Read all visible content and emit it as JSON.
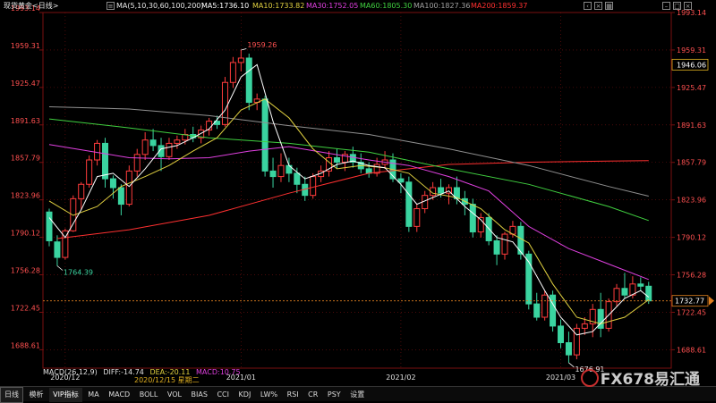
{
  "header": {
    "instrument": "现货黄金<日线>",
    "ma_label": "MA(5,10,30,60,100,200)",
    "ma5": "MA5:1736.10",
    "ma10": "MA10:1733.82",
    "ma30": "MA30:1752.05",
    "ma60": "MA60:1805.30",
    "ma100": "MA100:1827.36",
    "ma200": "MA200:1859.37"
  },
  "colors": {
    "up": "#ff3c3c",
    "down": "#3ad4a0",
    "ma5": "#ffffff",
    "ma10": "#e0d040",
    "ma30": "#e040e0",
    "ma60": "#40d040",
    "ma100": "#909090",
    "ma200": "#ff3030",
    "grid": "#7a1010",
    "axis_text": "#ff5050"
  },
  "icons": [
    "menu-icon",
    "back-icon",
    "close-icon",
    "grid-icon",
    "minimize-icon",
    "maximize-icon",
    "close-window-icon"
  ],
  "chart_data": {
    "type": "candlestick",
    "ylim": [
      1672,
      1993.14
    ],
    "yticks": [
      "1993.14",
      "1959.31",
      "1925.47",
      "1891.63",
      "1857.79",
      "1823.96",
      "1790.12",
      "1756.28",
      "1722.45",
      "1688.61"
    ],
    "xticks": [
      {
        "label": "2020/12",
        "index": 2
      },
      {
        "label": "2021/01",
        "index": 24
      },
      {
        "label": "2021/02",
        "index": 44
      },
      {
        "label": "2021/03",
        "index": 64
      }
    ],
    "candles": [
      [
        1813,
        1816,
        1782,
        1787
      ],
      [
        1786,
        1792,
        1764.39,
        1772
      ],
      [
        1772,
        1798,
        1770,
        1796
      ],
      [
        1796,
        1828,
        1795,
        1825
      ],
      [
        1825,
        1840,
        1815,
        1838
      ],
      [
        1838,
        1864,
        1835,
        1860
      ],
      [
        1860,
        1878,
        1855,
        1875
      ],
      [
        1875,
        1880,
        1835,
        1843
      ],
      [
        1843,
        1846,
        1825,
        1835
      ],
      [
        1835,
        1838,
        1810,
        1820
      ],
      [
        1820,
        1855,
        1818,
        1850
      ],
      [
        1850,
        1870,
        1845,
        1865
      ],
      [
        1865,
        1885,
        1860,
        1878
      ],
      [
        1878,
        1888,
        1868,
        1873
      ],
      [
        1873,
        1880,
        1850,
        1863
      ],
      [
        1863,
        1880,
        1860,
        1875
      ],
      [
        1875,
        1882,
        1870,
        1878
      ],
      [
        1878,
        1888,
        1874,
        1883
      ],
      [
        1883,
        1890,
        1876,
        1880
      ],
      [
        1880,
        1891,
        1875,
        1887
      ],
      [
        1887,
        1898,
        1882,
        1895
      ],
      [
        1895,
        1900,
        1888,
        1892
      ],
      [
        1892,
        1935,
        1890,
        1930
      ],
      [
        1930,
        1953,
        1925,
        1948
      ],
      [
        1948,
        1959.26,
        1940,
        1952
      ],
      [
        1952,
        1956,
        1905,
        1912
      ],
      [
        1912,
        1920,
        1905,
        1915
      ],
      [
        1915,
        1918,
        1845,
        1850
      ],
      [
        1850,
        1862,
        1835,
        1845
      ],
      [
        1845,
        1866,
        1840,
        1855
      ],
      [
        1855,
        1862,
        1840,
        1848
      ],
      [
        1848,
        1853,
        1830,
        1838
      ],
      [
        1838,
        1845,
        1823,
        1828
      ],
      [
        1828,
        1848,
        1825,
        1845
      ],
      [
        1845,
        1855,
        1840,
        1850
      ],
      [
        1850,
        1868,
        1845,
        1862
      ],
      [
        1862,
        1870,
        1852,
        1858
      ],
      [
        1858,
        1868,
        1850,
        1865
      ],
      [
        1865,
        1872,
        1853,
        1858
      ],
      [
        1858,
        1866,
        1848,
        1852
      ],
      [
        1852,
        1858,
        1844,
        1848
      ],
      [
        1848,
        1862,
        1845,
        1856
      ],
      [
        1856,
        1868,
        1852,
        1860
      ],
      [
        1860,
        1866,
        1840,
        1843
      ],
      [
        1843,
        1848,
        1830,
        1840
      ],
      [
        1840,
        1845,
        1795,
        1800
      ],
      [
        1800,
        1820,
        1795,
        1816
      ],
      [
        1816,
        1832,
        1812,
        1828
      ],
      [
        1828,
        1840,
        1824,
        1835
      ],
      [
        1835,
        1843,
        1826,
        1830
      ],
      [
        1830,
        1838,
        1820,
        1835
      ],
      [
        1835,
        1845,
        1820,
        1825
      ],
      [
        1825,
        1832,
        1810,
        1820
      ],
      [
        1820,
        1825,
        1790,
        1795
      ],
      [
        1795,
        1812,
        1790,
        1808
      ],
      [
        1808,
        1812,
        1783,
        1787
      ],
      [
        1787,
        1792,
        1765,
        1775
      ],
      [
        1775,
        1795,
        1770,
        1793
      ],
      [
        1793,
        1805,
        1790,
        1800
      ],
      [
        1800,
        1804,
        1770,
        1775
      ],
      [
        1775,
        1778,
        1725,
        1730
      ],
      [
        1730,
        1740,
        1715,
        1718
      ],
      [
        1718,
        1742,
        1715,
        1738
      ],
      [
        1738,
        1742,
        1705,
        1710
      ],
      [
        1710,
        1716,
        1690,
        1695
      ],
      [
        1695,
        1705,
        1676.91,
        1684
      ],
      [
        1684,
        1712,
        1680,
        1708
      ],
      [
        1708,
        1718,
        1702,
        1712
      ],
      [
        1712,
        1730,
        1700,
        1725
      ],
      [
        1725,
        1740,
        1700,
        1708
      ],
      [
        1708,
        1735,
        1705,
        1732
      ],
      [
        1732,
        1748,
        1728,
        1744
      ],
      [
        1744,
        1758,
        1735,
        1738
      ],
      [
        1738,
        1755,
        1735,
        1748
      ],
      [
        1748,
        1754,
        1742,
        1746
      ],
      [
        1746,
        1750,
        1730,
        1732.77
      ]
    ],
    "ma_series": [
      {
        "name": "MA200",
        "color": "#ff3030",
        "points": [
          [
            1,
            1789
          ],
          [
            10,
            1797
          ],
          [
            20,
            1810
          ],
          [
            30,
            1830
          ],
          [
            40,
            1848
          ],
          [
            50,
            1856
          ],
          [
            60,
            1858
          ],
          [
            70,
            1859
          ],
          [
            75,
            1859.37
          ]
        ]
      },
      {
        "name": "MA100",
        "color": "#909090",
        "points": [
          [
            0,
            1908
          ],
          [
            10,
            1906
          ],
          [
            20,
            1900
          ],
          [
            30,
            1891
          ],
          [
            40,
            1883
          ],
          [
            50,
            1870
          ],
          [
            60,
            1855
          ],
          [
            70,
            1836
          ],
          [
            75,
            1827.36
          ]
        ]
      },
      {
        "name": "MA60",
        "color": "#40d040",
        "points": [
          [
            0,
            1897
          ],
          [
            10,
            1889
          ],
          [
            20,
            1880
          ],
          [
            30,
            1875
          ],
          [
            40,
            1867
          ],
          [
            50,
            1852
          ],
          [
            60,
            1838
          ],
          [
            70,
            1818
          ],
          [
            75,
            1805.3
          ]
        ]
      },
      {
        "name": "MA30",
        "color": "#e040e0",
        "points": [
          [
            0,
            1874
          ],
          [
            5,
            1868
          ],
          [
            10,
            1862
          ],
          [
            15,
            1861
          ],
          [
            20,
            1862
          ],
          [
            25,
            1868
          ],
          [
            30,
            1872
          ],
          [
            35,
            1866
          ],
          [
            40,
            1860
          ],
          [
            45,
            1855
          ],
          [
            50,
            1845
          ],
          [
            55,
            1832
          ],
          [
            60,
            1800
          ],
          [
            65,
            1780
          ],
          [
            70,
            1766
          ],
          [
            75,
            1752.05
          ]
        ]
      },
      {
        "name": "MA10",
        "color": "#e0d040",
        "points": [
          [
            0,
            1823
          ],
          [
            3,
            1810
          ],
          [
            6,
            1818
          ],
          [
            9,
            1836
          ],
          [
            12,
            1845
          ],
          [
            15,
            1855
          ],
          [
            18,
            1868
          ],
          [
            21,
            1880
          ],
          [
            24,
            1905
          ],
          [
            27,
            1915
          ],
          [
            30,
            1898
          ],
          [
            33,
            1870
          ],
          [
            36,
            1852
          ],
          [
            39,
            1855
          ],
          [
            42,
            1853
          ],
          [
            45,
            1848
          ],
          [
            48,
            1830
          ],
          [
            51,
            1826
          ],
          [
            54,
            1816
          ],
          [
            57,
            1797
          ],
          [
            60,
            1785
          ],
          [
            63,
            1748
          ],
          [
            66,
            1718
          ],
          [
            69,
            1712
          ],
          [
            72,
            1718
          ],
          [
            75,
            1733.82
          ]
        ]
      },
      {
        "name": "MA5",
        "color": "#ffffff",
        "points": [
          [
            0,
            1808
          ],
          [
            2,
            1790
          ],
          [
            4,
            1815
          ],
          [
            6,
            1845
          ],
          [
            8,
            1848
          ],
          [
            10,
            1836
          ],
          [
            12,
            1852
          ],
          [
            14,
            1870
          ],
          [
            16,
            1873
          ],
          [
            18,
            1880
          ],
          [
            20,
            1888
          ],
          [
            22,
            1905
          ],
          [
            24,
            1935
          ],
          [
            26,
            1946
          ],
          [
            28,
            1895
          ],
          [
            30,
            1855
          ],
          [
            32,
            1843
          ],
          [
            34,
            1848
          ],
          [
            36,
            1856
          ],
          [
            38,
            1859
          ],
          [
            40,
            1855
          ],
          [
            42,
            1853
          ],
          [
            44,
            1838
          ],
          [
            46,
            1820
          ],
          [
            48,
            1826
          ],
          [
            50,
            1832
          ],
          [
            52,
            1818
          ],
          [
            54,
            1806
          ],
          [
            56,
            1790
          ],
          [
            58,
            1786
          ],
          [
            60,
            1768
          ],
          [
            62,
            1742
          ],
          [
            64,
            1718
          ],
          [
            66,
            1702
          ],
          [
            68,
            1705
          ],
          [
            70,
            1720
          ],
          [
            72,
            1735
          ],
          [
            74,
            1742
          ],
          [
            75,
            1736.1
          ]
        ]
      }
    ],
    "labels": {
      "high": "1959.26",
      "low_a": "1764.39",
      "low_b": "1676.91"
    },
    "price_markers": {
      "current": "1732.77",
      "ref": "1946.06"
    }
  },
  "macd": {
    "title": "MACD(26,12,9)",
    "diff": "DIFF:-14.74",
    "dea": "DEA:-20.11",
    "macd": "MACD:10.75",
    "date": "2020/12/15 星期二"
  },
  "toolbar": {
    "timeframe": "日线",
    "items": [
      "模析",
      "VIP指标",
      "MA",
      "MACD",
      "BOLL",
      "VOL",
      "BIAS",
      "CCI",
      "KDJ",
      "LW%",
      "RSI",
      "CR",
      "PSY",
      "设置"
    ]
  },
  "watermark": {
    "text": "FX678易汇通"
  }
}
